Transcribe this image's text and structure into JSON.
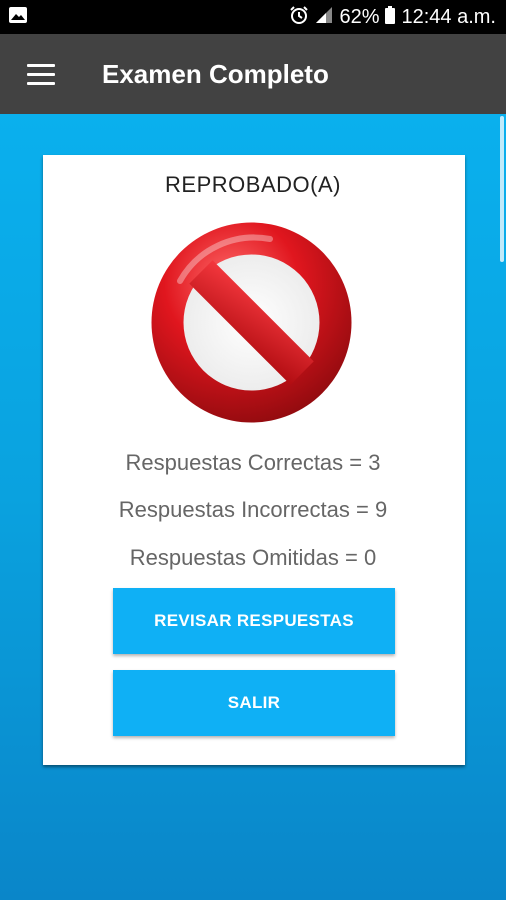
{
  "status_bar": {
    "battery_percent": "62%",
    "time": "12:44 a.m.",
    "icons": [
      "image-icon",
      "alarm-icon",
      "signal-icon",
      "battery-icon"
    ]
  },
  "app_bar": {
    "title": "Examen Completo",
    "menu_icon": "menu-icon"
  },
  "result": {
    "title": "REPROBADO(A)",
    "icon": "prohibited-sign-icon",
    "stats": {
      "correct": "Respuestas Correctas = 3",
      "incorrect": "Respuestas Incorrectas = 9",
      "omitted": "Respuestas Omitidas = 0"
    }
  },
  "buttons": {
    "review": "REVISAR RESPUESTAS",
    "exit": "SALIR"
  },
  "colors": {
    "app_bar": "#424242",
    "background": "#0aa2df",
    "button": "#0fb0f5",
    "sign": "#d0131a"
  }
}
